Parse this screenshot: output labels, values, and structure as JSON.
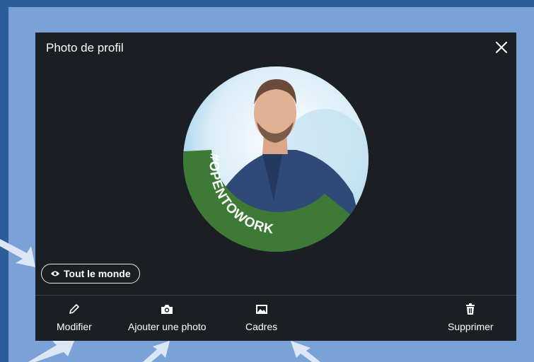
{
  "dialog": {
    "title": "Photo de profil",
    "close_icon": "close-icon"
  },
  "photo": {
    "frame_text": "#OPENTOWORK",
    "frame_color": "#3d7a35"
  },
  "visibility": {
    "icon": "eye-icon",
    "label": "Tout le monde"
  },
  "actions": [
    {
      "label": "Modifier",
      "icon": "pencil-icon"
    },
    {
      "label": "Ajouter une photo",
      "icon": "camera-icon"
    },
    {
      "label": "Cadres",
      "icon": "image-icon"
    },
    {
      "label": "Supprimer",
      "icon": "trash-icon"
    }
  ],
  "colors": {
    "modal_bg": "#1b1f23",
    "page_bg": "#7aa2d6",
    "outer_bg": "#2b5d98",
    "arrow": "#dce6f5"
  }
}
